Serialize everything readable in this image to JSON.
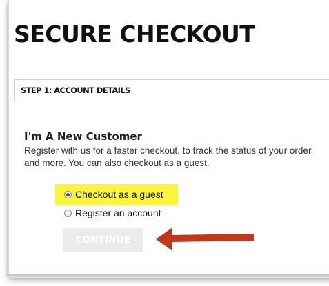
{
  "page": {
    "title": "SECURE CHECKOUT"
  },
  "step": {
    "label": "STEP 1: ACCOUNT DETAILS"
  },
  "new_customer": {
    "heading": "I'm A New Customer",
    "description": "Register with us for a faster checkout, to track the status of your order and more. You can also checkout as a guest."
  },
  "options": [
    {
      "label": "Checkout as a guest",
      "selected": true
    },
    {
      "label": "Register an account",
      "selected": false
    }
  ],
  "actions": {
    "continue_label": "CONTINUE"
  },
  "colors": {
    "highlight": "#fbf63b",
    "arrow": "#c0391c",
    "button_bg": "#ebebeb"
  },
  "annotations": {
    "arrow_icon": "left-arrow-icon"
  }
}
